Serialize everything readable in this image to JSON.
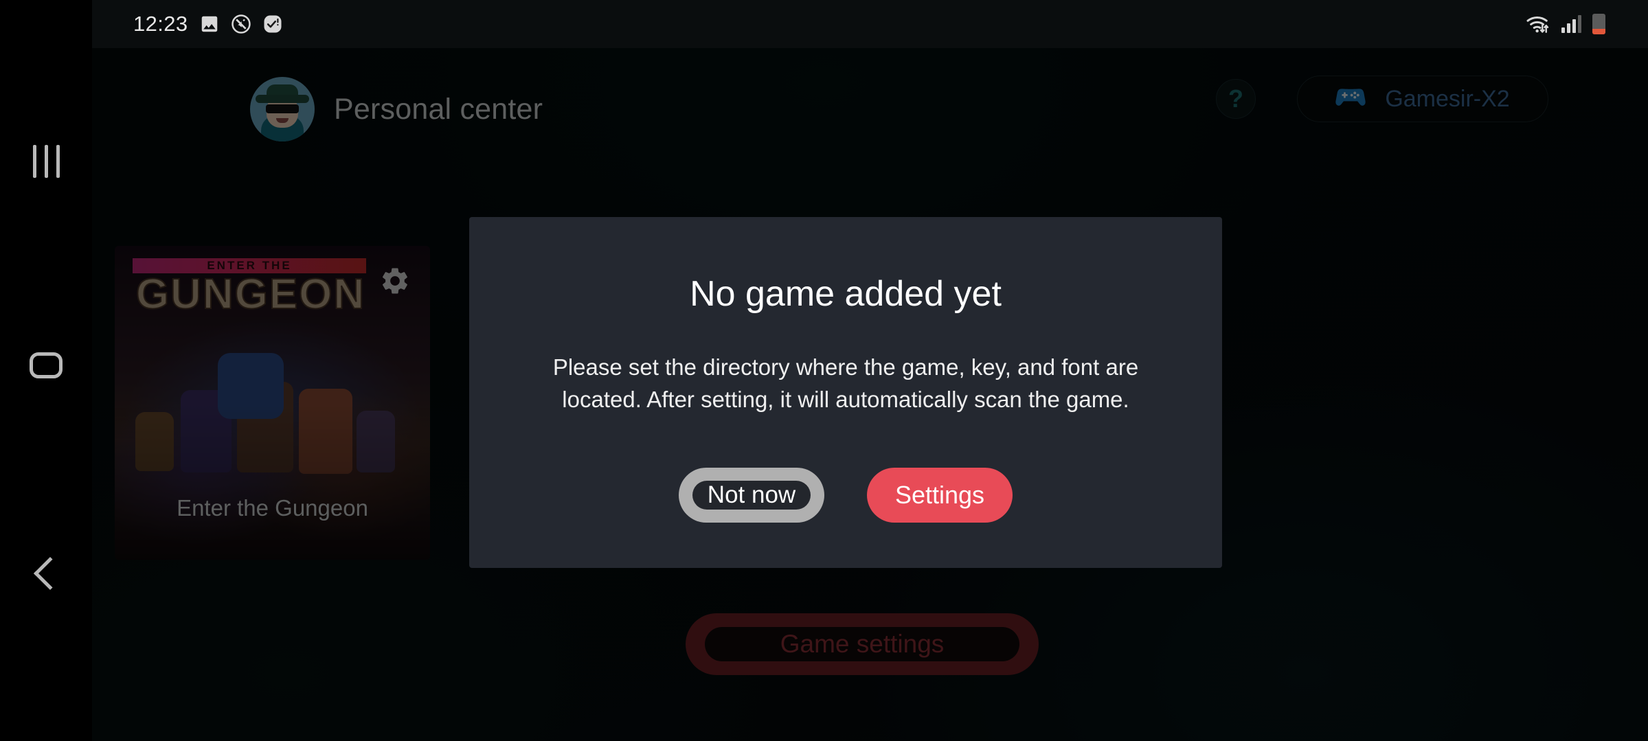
{
  "statusbar": {
    "clock": "12:23",
    "left_icons": [
      "image-icon",
      "no-sound-icon",
      "check-badge-icon"
    ],
    "right_icons": [
      "wifi-transfer-icon",
      "cellular-signal-icon",
      "battery-low-icon"
    ],
    "battery_level_pct": 26,
    "signal_bars_filled": 3,
    "battery_color": "#e2573a"
  },
  "navbar": {
    "recents_label": "recents-icon",
    "home_label": "home-icon",
    "back_label": "back-icon"
  },
  "header": {
    "profile_name": "Personal center",
    "avatar_name": "user-avatar",
    "help_label": "?",
    "controller": {
      "label": "Gamesir-X2",
      "icon": "gamepad-icon",
      "text_color": "#3d6b9a"
    }
  },
  "game_card": {
    "label": "Enter the Gungeon",
    "art_title_top": "ENTER THE",
    "art_title_main": "GUNGEON",
    "gear_icon": "gear-icon"
  },
  "bottom_bar": {
    "game_settings_label": "Game settings",
    "accent_color": "#6b2025"
  },
  "dialog": {
    "title": "No game added yet",
    "body": "Please set the directory where the game, key, and font are located. After setting, it will automatically scan the game.",
    "buttons": {
      "secondary": "Not now",
      "primary": "Settings"
    },
    "primary_color": "#e84b57",
    "secondary_color": "#b0b0b0",
    "background_color": "#242830"
  }
}
